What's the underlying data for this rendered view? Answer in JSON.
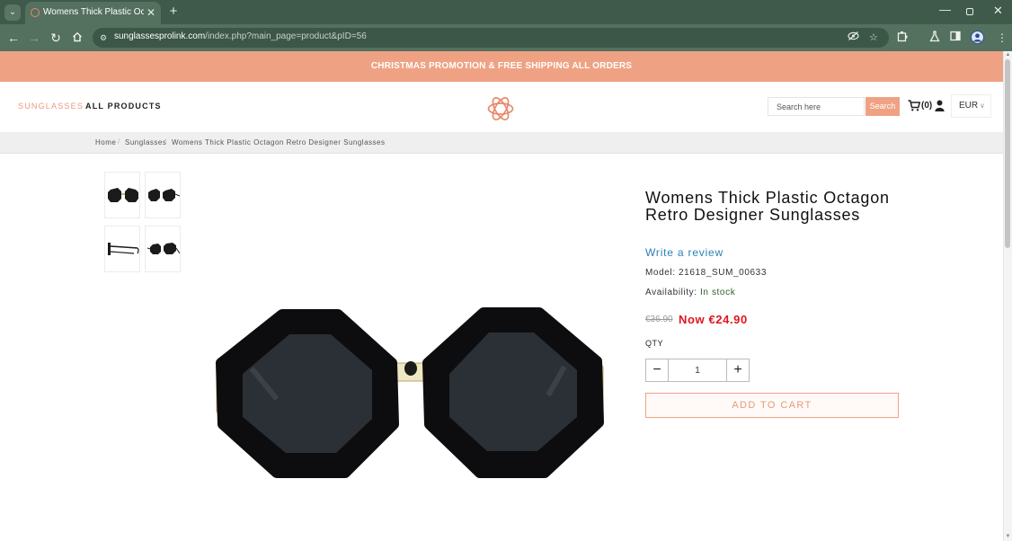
{
  "browser": {
    "tab_title": "Womens Thick Plastic Octagon Retro Designer Sunglasses",
    "url_host": "sunglassesprolink.com",
    "url_path": "/index.php?main_page=product&pID=56",
    "icons": {
      "tab_menu": "chevron-down-icon",
      "tab_close": "close-icon",
      "new_tab": "plus-icon",
      "back": "arrow-left-icon",
      "forward": "arrow-right-icon",
      "reload": "reload-icon",
      "home": "home-icon",
      "site_info": "tune-icon",
      "eye_off": "eye-off-icon",
      "bookmark": "star-icon",
      "extensions": "puzzle-icon",
      "labs": "flask-icon",
      "side_panel": "side-panel-icon",
      "profile": "profile-icon",
      "menu": "more-vert-icon"
    }
  },
  "promo": {
    "text": "CHRISTMAS PROMOTION & FREE SHIPPING ALL ORDERS"
  },
  "header": {
    "nav": [
      "SUNGLASSES",
      "ALL PRODUCTS"
    ],
    "search_placeholder": "Search here",
    "search_button": "Search",
    "cart_count": "(0)",
    "currency": "EUR"
  },
  "breadcrumb": [
    "Home",
    "Sunglasses",
    "Womens Thick Plastic Octagon Retro Designer Sunglasses"
  ],
  "product": {
    "title": "Womens Thick Plastic Octagon Retro Designer Sunglasses",
    "review_link": "Write a review",
    "model_label": "Model:",
    "model_value": "21618_SUM_00633",
    "availability_label": "Availability:",
    "availability_value": "In stock",
    "old_price": "€36.90",
    "new_price": "Now €24.90",
    "qty_label": "QTY",
    "qty_value": "1",
    "add_to_cart": "ADD TO CART"
  },
  "colors": {
    "accent": "#efa283",
    "accent_text": "#e69a7c",
    "sale_red": "#e0151d",
    "link_blue": "#2a7fb8",
    "stock_green": "#2f5d2a",
    "browser_frame": "#3f5a4a",
    "browser_toolbar": "#54705f"
  }
}
